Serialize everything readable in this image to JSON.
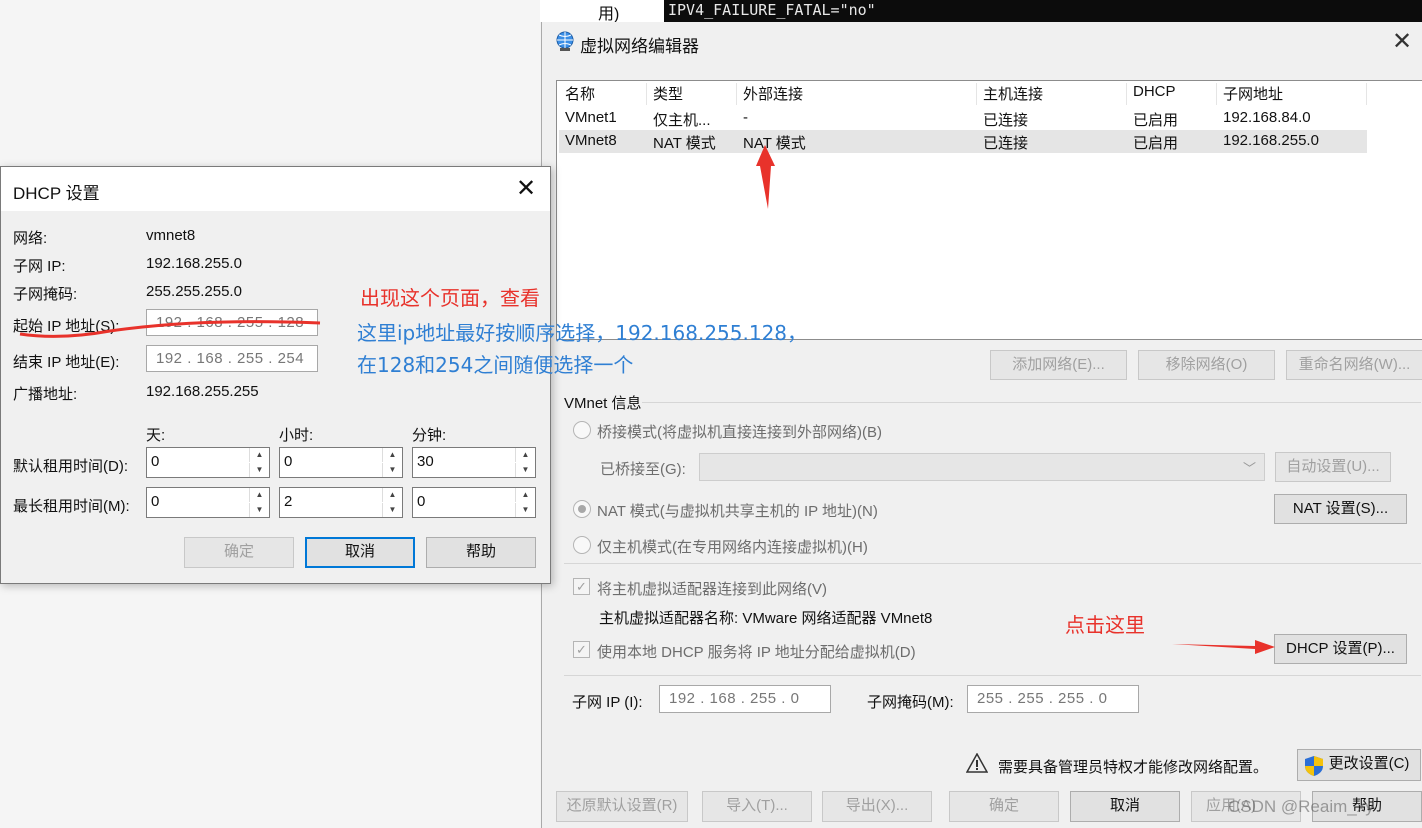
{
  "background": {
    "term_cell": "用)",
    "terminal_line": "IPV4_FAILURE_FATAL=\"no\""
  },
  "vne": {
    "title": "虚拟网络编辑器",
    "columns": [
      "名称",
      "类型",
      "外部连接",
      "主机连接",
      "DHCP",
      "子网地址"
    ],
    "rows": [
      {
        "name": "VMnet1",
        "type": "仅主机...",
        "external": "-",
        "host": "已连接",
        "dhcp": "已启用",
        "subnet": "192.168.84.0"
      },
      {
        "name": "VMnet8",
        "type": "NAT 模式",
        "external": "NAT 模式",
        "host": "已连接",
        "dhcp": "已启用",
        "subnet": "192.168.255.0"
      }
    ],
    "add_net": "添加网络(E)...",
    "remove_net": "移除网络(O)",
    "rename_net": "重命名网络(W)...",
    "info_title": "VMnet 信息",
    "bridge_mode": "桥接模式(将虚拟机直接连接到外部网络)(B)",
    "bridged_to": "已桥接至(G):",
    "auto_settings": "自动设置(U)...",
    "nat_mode": "NAT 模式(与虚拟机共享主机的 IP 地址)(N)",
    "nat_settings": "NAT 设置(S)...",
    "host_only": "仅主机模式(在专用网络内连接虚拟机)(H)",
    "connect_adapter": "将主机虚拟适配器连接到此网络(V)",
    "adapter_name": "主机虚拟适配器名称: VMware 网络适配器 VMnet8",
    "use_dhcp": "使用本地 DHCP 服务将 IP 地址分配给虚拟机(D)",
    "dhcp_settings": "DHCP 设置(P)...",
    "subnet_ip_label": "子网 IP (I):",
    "subnet_ip": "192 . 168 . 255 .   0",
    "subnet_mask_label": "子网掩码(M):",
    "subnet_mask": "255 . 255 . 255 .   0",
    "admin_notice": "需要具备管理员特权才能修改网络配置。",
    "change_settings": "更改设置(C)",
    "restore_defaults": "还原默认设置(R)",
    "import": "导入(T)...",
    "export": "导出(X)...",
    "ok": "确定",
    "cancel": "取消",
    "apply": "应用(A)",
    "help": "帮助"
  },
  "dhcp": {
    "title": "DHCP 设置",
    "network_label": "网络:",
    "network": "vmnet8",
    "subnet_ip_label": "子网 IP:",
    "subnet_ip": "192.168.255.0",
    "subnet_mask_label": "子网掩码:",
    "subnet_mask": "255.255.255.0",
    "start_ip_label": "起始 IP 地址(S):",
    "start_ip": "192 . 168 . 255 . 128",
    "end_ip_label": "结束 IP 地址(E):",
    "end_ip": "192 . 168 . 255 . 254",
    "broadcast_label": "广播地址:",
    "broadcast": "192.168.255.255",
    "days": "天:",
    "hours": "小时:",
    "minutes": "分钟:",
    "default_lease_label": "默认租用时间(D):",
    "default_lease": [
      "0",
      "0",
      "30"
    ],
    "max_lease_label": "最长租用时间(M):",
    "max_lease": [
      "0",
      "2",
      "0"
    ],
    "ok": "确定",
    "cancel": "取消",
    "help": "帮助"
  },
  "annotations": {
    "appear_text": "出现这个页面，查看",
    "blue_line1": "这里ip地址最好按顺序选择，192.168.255.128，",
    "blue_line2": "在128和254之间随便选择一个",
    "click_here": "点击这里",
    "watermark": "CSDN @Reaim_xy"
  },
  "colors": {
    "annotation_red": "#e8322b",
    "annotation_blue": "#2f7fd3",
    "focus_blue": "#0078d7"
  }
}
